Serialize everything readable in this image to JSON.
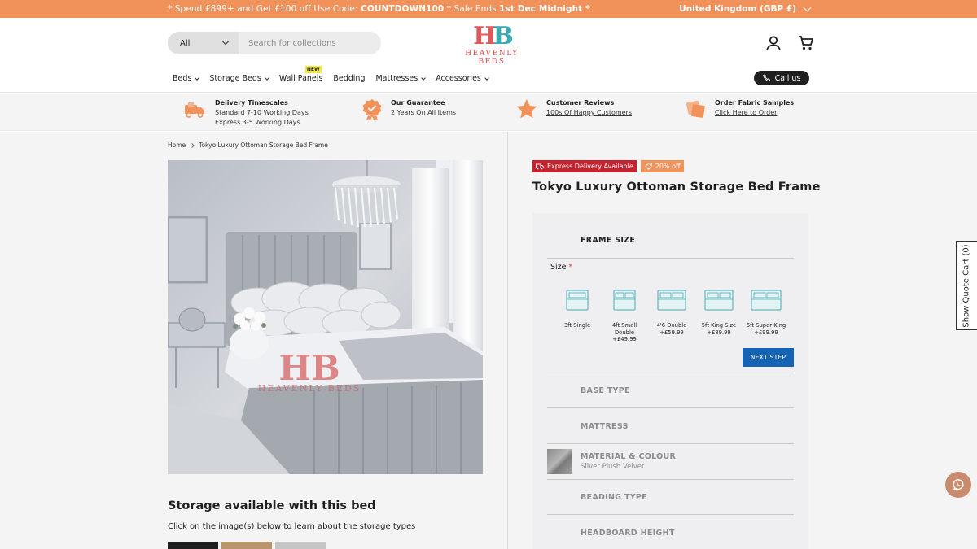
{
  "announcement": {
    "promo_pre": "* Spend £899+ and Get £100 off Use Code: ",
    "promo_code": "COUNTDOWN100",
    "promo_mid": " * Sale Ends ",
    "promo_date": "1st Dec Midnight",
    "promo_post": " *",
    "region": "United Kingdom (GBP £)"
  },
  "search": {
    "category": "All",
    "placeholder": "Search for collections"
  },
  "logo": {
    "mono_h": "H",
    "mono_b": "B",
    "word": "HEAVENLY BEDS"
  },
  "nav": {
    "items": [
      {
        "label": "Beds"
      },
      {
        "label": "Storage Beds"
      },
      {
        "label": "Wall Panels",
        "badge": "NEW"
      },
      {
        "label": "Bedding"
      },
      {
        "label": "Mattresses"
      },
      {
        "label": "Accessories"
      }
    ],
    "call_label": "Call us"
  },
  "usp": [
    {
      "title": "Delivery Timescales",
      "line1": "Standard 7-10 Working Days",
      "line2": "Express 3-5 Working Days"
    },
    {
      "title": "Our Guarantee",
      "line1": "2 Years On All Items"
    },
    {
      "title": "Customer Reviews",
      "line1": "100s Of Happy Customers"
    },
    {
      "title": "Order Fabric Samples",
      "line1": "Click Here to Order"
    }
  ],
  "breadcrumb": {
    "home": "Home",
    "current": "Tokyo Luxury Ottoman Storage Bed Frame"
  },
  "photo": {
    "watermark_mono": "HB",
    "watermark_word": "HEAVENLY BEDS"
  },
  "storage": {
    "title": "Storage available with this bed",
    "subtitle": "Click on the image(s) below to learn about the storage types"
  },
  "product": {
    "badge_express": "Express Delivery Available",
    "badge_discount": "20% off",
    "title": "Tokyo Luxury Ottoman Storage Bed Frame"
  },
  "config": {
    "frame_size": "FRAME SIZE",
    "size_label": "Size",
    "size_required": "*",
    "sizes": [
      {
        "line1": "3ft Single",
        "line2": "",
        "line3": ""
      },
      {
        "line1": "4ft Small",
        "line2": "Double",
        "line3": "+£49.99"
      },
      {
        "line1": "4'6 Double",
        "line2": "+£59.99",
        "line3": ""
      },
      {
        "line1": "5ft King Size",
        "line2": "+£89.99",
        "line3": ""
      },
      {
        "line1": "6ft Super King",
        "line2": "+£99.99",
        "line3": ""
      }
    ],
    "next_step": "NEXT STEP",
    "base_type": "BASE TYPE",
    "mattress": "MATTRESS",
    "material": "MATERIAL & COLOUR",
    "material_value": "Silver Plush Velvet",
    "beading": "BEADING TYPE",
    "headboard": "HEADBOARD HEIGHT"
  },
  "sidetab": {
    "label": "Show Quote Cart (0)"
  }
}
